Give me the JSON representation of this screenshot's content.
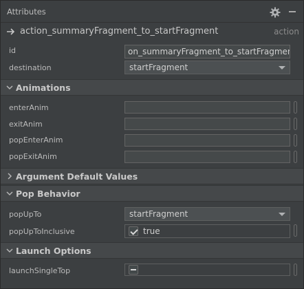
{
  "panel": {
    "title": "Attributes",
    "icons": {
      "settings": "gear-icon",
      "hide": "minimize-icon"
    }
  },
  "action": {
    "name": "action_summaryFragment_to_startFragment",
    "type": "action",
    "icon": "arrow-right-icon"
  },
  "properties": {
    "id": {
      "label": "id",
      "value": "on_summaryFragment_to_startFragment"
    },
    "destination": {
      "label": "destination",
      "value": "startFragment"
    }
  },
  "animations": {
    "title": "Animations",
    "expanded": true,
    "fields": [
      {
        "label": "enterAnim",
        "value": ""
      },
      {
        "label": "exitAnim",
        "value": ""
      },
      {
        "label": "popEnterAnim",
        "value": ""
      },
      {
        "label": "popExitAnim",
        "value": ""
      }
    ]
  },
  "argument_defaults": {
    "title": "Argument Default Values",
    "expanded": false
  },
  "pop_behavior": {
    "title": "Pop Behavior",
    "expanded": true,
    "popUpTo": {
      "label": "popUpTo",
      "value": "startFragment"
    },
    "popUpToInclusive": {
      "label": "popUpToInclusive",
      "value": "true",
      "checked": true
    }
  },
  "launch_options": {
    "title": "Launch Options",
    "expanded": true,
    "launchSingleTop": {
      "label": "launchSingleTop",
      "value": "",
      "state": "indeterminate"
    }
  }
}
